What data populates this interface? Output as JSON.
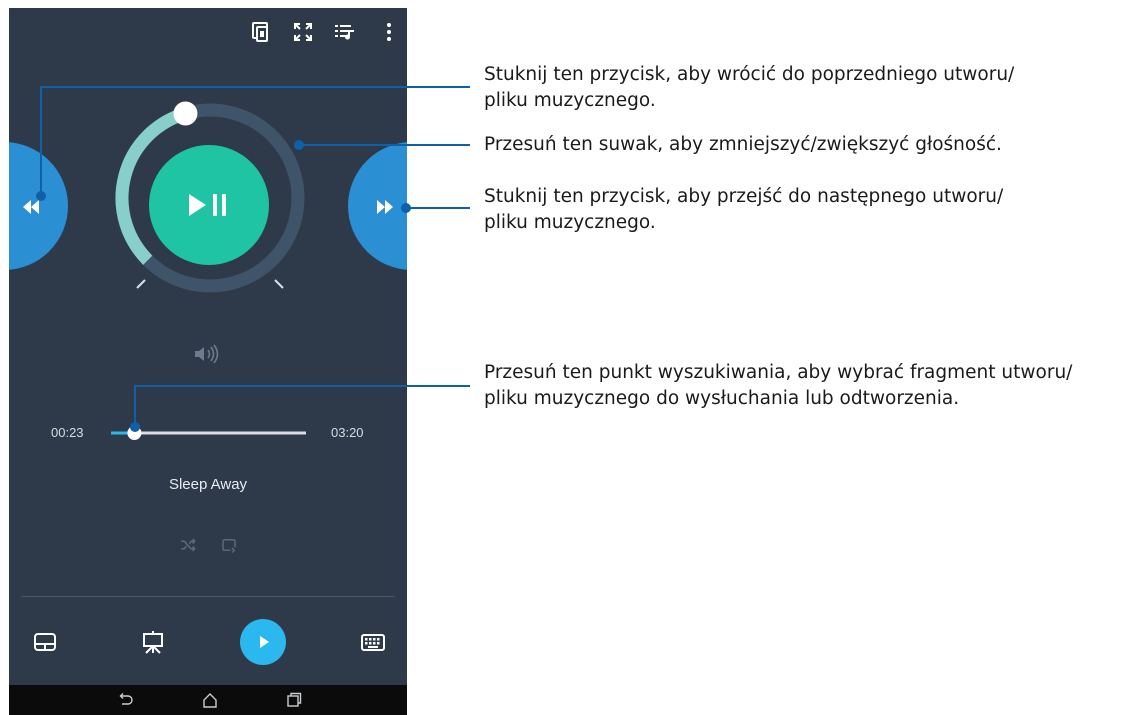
{
  "player": {
    "time_elapsed": "00:23",
    "time_total": "03:20",
    "song_title": "Sleep Away",
    "seek_progress": 0.12,
    "volume_level": 0.44,
    "icons": {
      "top_bar": [
        "cast-screen-icon",
        "fullscreen-icon",
        "playlist-icon",
        "more-options-icon"
      ],
      "previous": "rewind-icon",
      "play_pause": "play-pause-icon",
      "next": "fast-forward-icon",
      "volume": "speaker-icon",
      "shuffle": "shuffle-icon",
      "repeat": "repeat-icon"
    }
  },
  "bottom_bar": {
    "icons": [
      "touchpad-icon",
      "presentation-icon",
      "play-icon",
      "keyboard-icon"
    ]
  },
  "nav_bar": {
    "icons": [
      "back-icon",
      "home-icon",
      "recent-apps-icon"
    ]
  },
  "callouts": {
    "previous_line1": "Stuknij ten przycisk, aby wrócić do poprzedniego utworu/",
    "previous_line2": "pliku muzycznego.",
    "volume_line1": "Przesuń ten suwak, aby zmniejszyć/zwiększyć głośność.",
    "next_line1": "Stuknij ten przycisk, aby przejść do następnego utworu/",
    "next_line2": "pliku muzycznego.",
    "seek_line1": "Przesuń ten punkt wyszukiwania, aby wybrać fragment utworu/",
    "seek_line2": "pliku muzycznego do wysłuchania lub odtworzenia."
  },
  "colors": {
    "phone_background": "#2e3a4a",
    "play_button": "#1fc4a4",
    "volume_arc": "#88cfc9",
    "side_buttons": "#2b8fd3",
    "bottom_play": "#2ab8ef",
    "callout_line": "#0e60a8"
  }
}
